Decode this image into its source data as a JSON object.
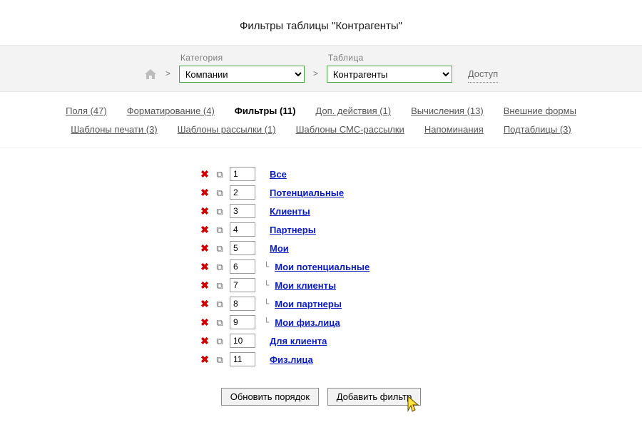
{
  "page_title": "Фильтры таблицы \"Контрагенты\"",
  "breadcrumb": {
    "category_label": "Категория",
    "table_label": "Таблица",
    "category_value": "Компании",
    "table_value": "Контрагенты",
    "access_link": "Доступ",
    "sep": ">"
  },
  "tabs": [
    {
      "label": "Поля (47)",
      "current": false
    },
    {
      "label": "Форматирование (4)",
      "current": false
    },
    {
      "label": "Фильтры (11)",
      "current": true
    },
    {
      "label": "Доп. действия (1)",
      "current": false
    },
    {
      "label": "Вычисления (13)",
      "current": false
    },
    {
      "label": "Внешние формы",
      "current": false
    },
    {
      "label": "Шаблоны печати (3)",
      "current": false
    },
    {
      "label": "Шаблоны рассылки (1)",
      "current": false
    },
    {
      "label": "Шаблоны СМС-рассылки",
      "current": false
    },
    {
      "label": "Напоминания",
      "current": false
    },
    {
      "label": "Подтаблицы (3)",
      "current": false
    }
  ],
  "filters": [
    {
      "order": "1",
      "name": "Все",
      "child": false
    },
    {
      "order": "2",
      "name": "Потенциальные",
      "child": false
    },
    {
      "order": "3",
      "name": "Клиенты",
      "child": false
    },
    {
      "order": "4",
      "name": "Партнеры",
      "child": false
    },
    {
      "order": "5",
      "name": "Мои",
      "child": false
    },
    {
      "order": "6",
      "name": "Мои потенциальные",
      "child": true
    },
    {
      "order": "7",
      "name": "Мои клиенты",
      "child": true
    },
    {
      "order": "8",
      "name": "Мои партнеры",
      "child": true
    },
    {
      "order": "9",
      "name": "Мои физ.лица",
      "child": true
    },
    {
      "order": "10",
      "name": "Для клиента",
      "child": false
    },
    {
      "order": "11",
      "name": "Физ.лица",
      "child": false
    }
  ],
  "buttons": {
    "update_order": "Обновить порядок",
    "add_filter": "Добавить фильтр"
  },
  "tree_glyph": "└"
}
